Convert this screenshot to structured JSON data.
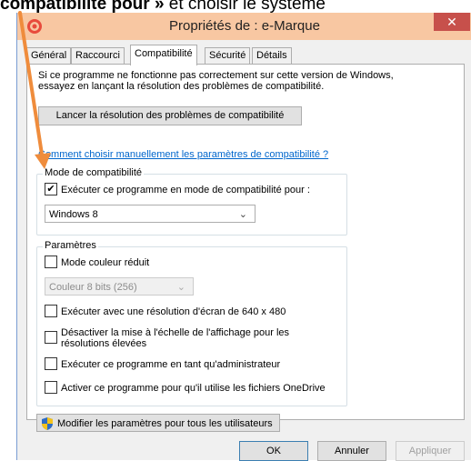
{
  "caption": {
    "bold": "compatibilité pour »",
    "rest": " et choisir le système"
  },
  "window": {
    "title": "Propriétés de : e-Marque",
    "close": "✕"
  },
  "tabs": [
    {
      "label": "Général"
    },
    {
      "label": "Raccourci"
    },
    {
      "label": "Compatibilité"
    },
    {
      "label": "Sécurité"
    },
    {
      "label": "Détails"
    }
  ],
  "panel": {
    "description": "Si ce programme ne fonctionne pas correctement sur cette version de Windows, essayez en lançant la résolution des problèmes de compatibilité.",
    "troubleshoot_button": "Lancer la résolution des problèmes de compatibilité",
    "manual_link": "Comment choisir manuellement les paramètres de compatibilité ?",
    "compat_group": {
      "title": "Mode de compatibilité",
      "checkbox_label": "Exécuter ce programme en mode de compatibilité pour :",
      "checked": true,
      "selected_os": "Windows 8"
    },
    "settings_group": {
      "title": "Paramètres",
      "reduced_color_label": "Mode couleur réduit",
      "color_select": "Couleur 8 bits (256)",
      "res_640_label": "Exécuter avec une résolution d'écran de 640 x 480",
      "dpi_label_line1": "Désactiver la mise à l'échelle de l'affichage pour les",
      "dpi_label_line2": "résolutions élevées",
      "admin_label": "Exécuter ce programme en tant qu'administrateur",
      "onedrive_label": "Activer ce programme pour qu'il utilise les fichiers OneDrive"
    },
    "all_users_button": "Modifier les paramètres pour tous les utilisateurs"
  },
  "footer": {
    "ok": "OK",
    "cancel": "Annuler",
    "apply": "Appliquer"
  },
  "colors": {
    "titlebar": "#f8c7a2",
    "close": "#c7504b",
    "arrow": "#ef8c3c",
    "link": "#0066cc"
  }
}
